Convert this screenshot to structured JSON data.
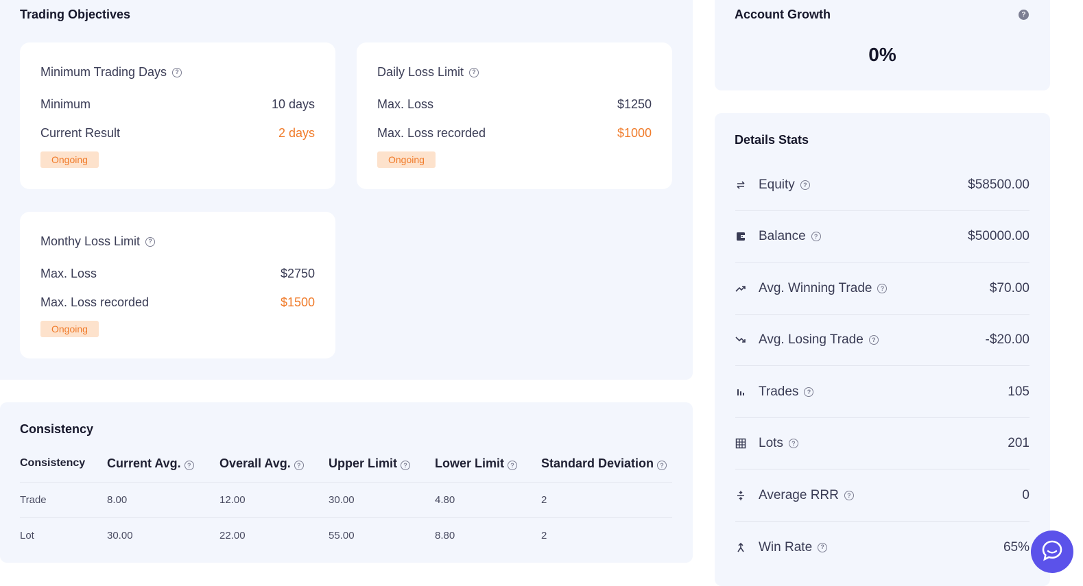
{
  "objectives": {
    "title": "Trading Objectives",
    "cards": [
      {
        "title": "Minimum Trading Days",
        "row1_label": "Minimum",
        "row1_value": "10 days",
        "row2_label": "Current Result",
        "row2_value": "2 days",
        "status": "Ongoing"
      },
      {
        "title": "Daily Loss Limit",
        "row1_label": "Max. Loss",
        "row1_value": "$1250",
        "row2_label": "Max. Loss recorded",
        "row2_value": "$1000",
        "status": "Ongoing"
      },
      {
        "title": "Monthy Loss Limit",
        "row1_label": "Max. Loss",
        "row1_value": "$2750",
        "row2_label": "Max. Loss recorded",
        "row2_value": "$1500",
        "status": "Ongoing"
      }
    ]
  },
  "consistency": {
    "title": "Consistency",
    "headers": [
      "Consistency",
      "Current Avg.",
      "Overall Avg.",
      "Upper Limit",
      "Lower Limit",
      "Standard Deviation"
    ],
    "rows": [
      [
        "Trade",
        "8.00",
        "12.00",
        "30.00",
        "4.80",
        "2"
      ],
      [
        "Lot",
        "30.00",
        "22.00",
        "55.00",
        "8.80",
        "2"
      ]
    ]
  },
  "growth": {
    "title": "Account Growth",
    "value": "0%"
  },
  "stats": {
    "title": "Details Stats",
    "items": [
      {
        "label": "Equity",
        "value": "$58500.00",
        "icon": "transfer-icon"
      },
      {
        "label": "Balance",
        "value": "$50000.00",
        "icon": "wallet-icon"
      },
      {
        "label": "Avg. Winning Trade",
        "value": "$70.00",
        "icon": "trending-up-icon"
      },
      {
        "label": "Avg. Losing Trade",
        "value": "-$20.00",
        "icon": "trending-down-icon"
      },
      {
        "label": "Trades",
        "value": "105",
        "icon": "bar-chart-icon"
      },
      {
        "label": "Lots",
        "value": "201",
        "icon": "grid-icon"
      },
      {
        "label": "Average RRR",
        "value": "0",
        "icon": "divide-icon"
      },
      {
        "label": "Win Rate",
        "value": "65%",
        "icon": "figure-icon"
      }
    ]
  },
  "colors": {
    "accent_orange": "#f07b2a",
    "badge_bg": "#fde2cc",
    "panel_bg": "#f3f6fd",
    "chat_purple": "#5b52ea"
  }
}
